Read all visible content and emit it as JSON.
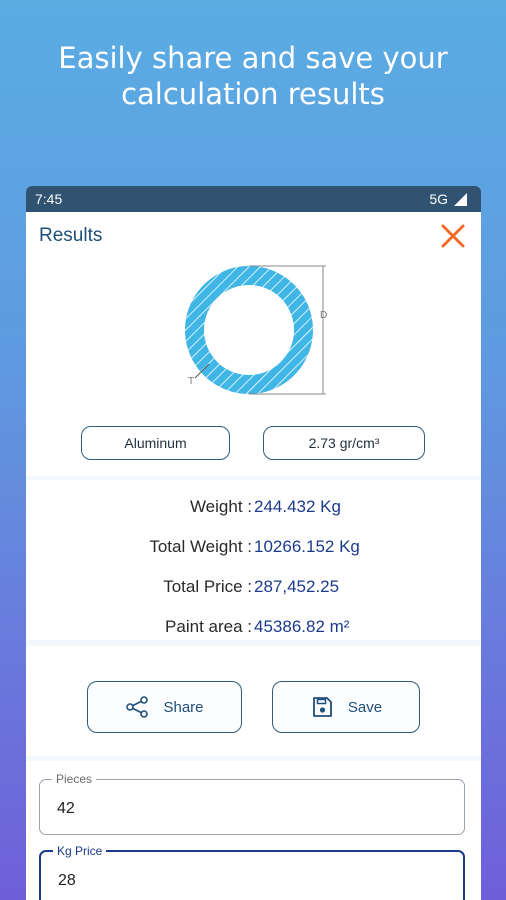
{
  "promo": {
    "line1": "Easily share and save your",
    "line2": "calculation results"
  },
  "status_bar": {
    "time": "7:45",
    "network": "5G",
    "signal_icon": "signal-icon"
  },
  "header": {
    "title": "Results",
    "close_icon": "close-icon"
  },
  "diagram": {
    "diameter_label": "D",
    "thickness_label": "T"
  },
  "material": {
    "name": "Aluminum",
    "density": "2.73 gr/cm³"
  },
  "results": [
    {
      "label": "Weight :",
      "value": "244.432 Kg"
    },
    {
      "label": "Total Weight :",
      "value": "10266.152 Kg"
    },
    {
      "label": "Total Price :",
      "value": "287,452.25"
    },
    {
      "label": "Paint area :",
      "value": "45386.82 m²"
    }
  ],
  "actions": {
    "share_label": "Share",
    "save_label": "Save"
  },
  "inputs": {
    "pieces_label": "Pieces",
    "pieces_value": "42",
    "kg_price_label": "Kg Price",
    "kg_price_value": "28"
  },
  "colors": {
    "accent": "#1b3a8c",
    "pipe_fill": "#3fb6e6",
    "close": "#f06a2a",
    "status_bar": "#2f5370"
  }
}
